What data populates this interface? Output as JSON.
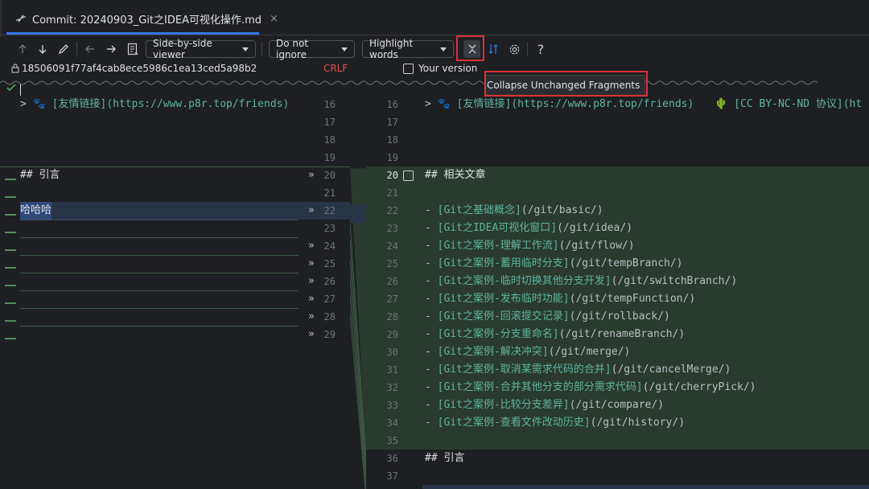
{
  "tab": {
    "title": "Commit: 20240903_Git之IDEA可视化操作.md",
    "close": "×"
  },
  "toolbar": {
    "viewer": "Side-by-side viewer",
    "ignore": "Do not ignore",
    "highlight": "Highlight words",
    "help": "?"
  },
  "info": {
    "hash": "18506091f77af4cab8ece5986c1ea13ced5a98b2",
    "line_ending": "CRLF",
    "your_version": "Your version"
  },
  "tooltip": "Collapse Unchanged Fragments",
  "left": {
    "first_line_prefix": ">",
    "first_line_link": "[友情链接](https://www.p8r.top/friends)",
    "heading": "## 引言",
    "text": "哈哈哈",
    "line_numbers": [
      "16",
      "17",
      "18",
      "19",
      "20",
      "21",
      "22",
      "23",
      "24",
      "25",
      "26",
      "27",
      "28",
      "29"
    ]
  },
  "right": {
    "first_line_prefix": ">",
    "first_line_link": "[友情链接](https://www.p8r.top/friends)",
    "first_line_extra": "[CC BY-NC-ND 协议](ht",
    "heading": "## 相关文章",
    "items": [
      {
        "dash": "-",
        "name": "[Git之基础概念]",
        "url": "(/git/basic/)"
      },
      {
        "dash": "-",
        "name": "[Git之IDEA可视化窗口]",
        "url": "(/git/idea/)"
      },
      {
        "dash": "-",
        "name": "[Git之案例-理解工作流]",
        "url": "(/git/flow/)"
      },
      {
        "dash": "-",
        "name": "[Git之案例-蓄用临时分支]",
        "url": "(/git/tempBranch/)"
      },
      {
        "dash": "-",
        "name": "[Git之案例-临时切换其他分支开发]",
        "url": "(/git/switchBranch/)"
      },
      {
        "dash": "-",
        "name": "[Git之案例-发布临时功能]",
        "url": "(/git/tempFunction/)"
      },
      {
        "dash": "-",
        "name": "[Git之案例-回滚提交记录]",
        "url": "(/git/rollback/)"
      },
      {
        "dash": "-",
        "name": "[Git之案例-分支重命名]",
        "url": "(/git/renameBranch/)"
      },
      {
        "dash": "-",
        "name": "[Git之案例-解决冲突]",
        "url": "(/git/merge/)"
      },
      {
        "dash": "-",
        "name": "[Git之案例-取消某需求代码的合并]",
        "url": "(/git/cancelMerge/)"
      },
      {
        "dash": "-",
        "name": "[Git之案例-合并其他分支的部分需求代码]",
        "url": "(/git/cherryPick/)"
      },
      {
        "dash": "-",
        "name": "[Git之案例-比较分支差异]",
        "url": "(/git/compare/)"
      },
      {
        "dash": "-",
        "name": "[Git之案例-查看文件改动历史]",
        "url": "(/git/history/)"
      }
    ],
    "heading2": "## 引言",
    "line_numbers": [
      "16",
      "17",
      "18",
      "19",
      "20",
      "21",
      "22",
      "23",
      "24",
      "25",
      "26",
      "27",
      "28",
      "29",
      "30",
      "31",
      "32",
      "33",
      "34",
      "35",
      "36",
      "37"
    ]
  },
  "colors": {
    "accent": "#3574f0",
    "added_bg": "#2a3a2e",
    "modified_bg": "#293447",
    "highlight_red": "#e0303a"
  }
}
